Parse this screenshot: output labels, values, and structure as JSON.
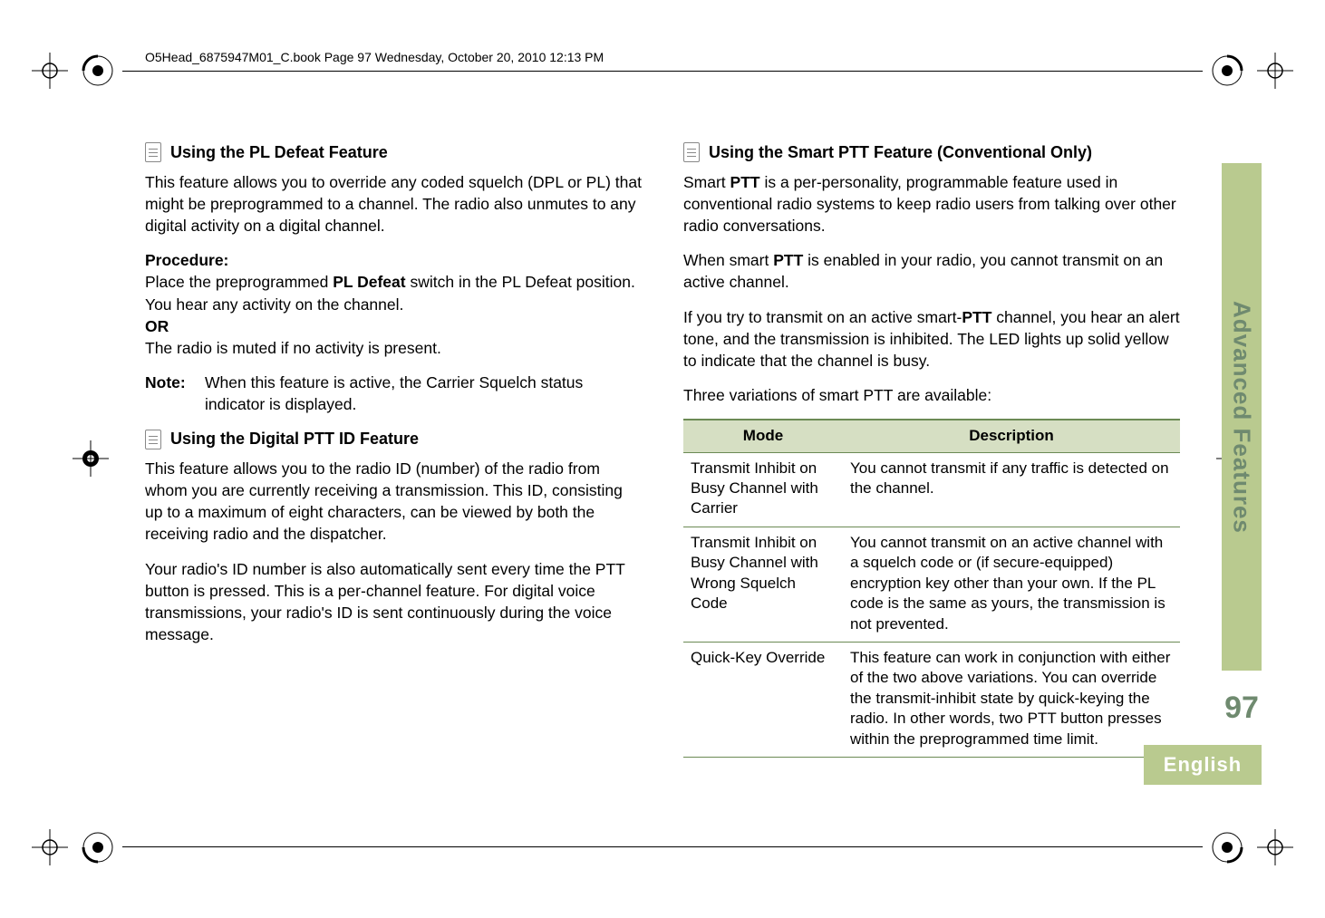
{
  "header_path": "O5Head_6875947M01_C.book  Page 97  Wednesday, October 20, 2010  12:13 PM",
  "side": {
    "section_label": "Advanced Features",
    "page_number": "97",
    "language": "English"
  },
  "left": {
    "h1": "Using the PL Defeat Feature",
    "p1": "This feature allows you to override any coded squelch (DPL or PL) that might be preprogrammed to a channel. The radio also unmutes to any digital activity on a digital channel.",
    "proc_label": "Procedure:",
    "proc1a": "Place the preprogrammed ",
    "proc1b_bold": "PL Defeat",
    "proc1c": " switch in the PL Defeat position. You hear any activity on the channel.",
    "or": "OR",
    "proc2": "The radio is muted if no activity is present.",
    "note_label": "Note:",
    "note_text": "When this feature is active, the Carrier Squelch status indicator is displayed.",
    "h2": "Using the Digital PTT ID Feature",
    "p2": "This feature allows you to the radio ID (number) of the radio from whom you are currently receiving a transmission. This ID, consisting up to a maximum of eight characters, can be viewed by both the receiving radio and the dispatcher.",
    "p3": "Your radio's ID number is also automatically sent every time the PTT button is pressed. This is a per-channel feature. For digital voice transmissions, your radio's ID is sent continuously during the voice message."
  },
  "right": {
    "h1": "Using the Smart PTT Feature (Conventional Only)",
    "p1a": "Smart ",
    "p1b_bold": "PTT",
    "p1c": " is a per-personality, programmable feature used in conventional radio systems to keep radio users from talking over other radio conversations.",
    "p2a": "When smart ",
    "p2b_bold": "PTT",
    "p2c": " is enabled in your radio, you cannot transmit on an active channel.",
    "p3a": "If you try to transmit on an active smart-",
    "p3b_bold": "PTT",
    "p3c": " channel, you hear an alert tone, and the transmission is inhibited. The LED lights up solid yellow to indicate that the channel is busy.",
    "p4": "Three variations of smart PTT are available:",
    "table": {
      "head_mode": "Mode",
      "head_desc": "Description",
      "rows": [
        {
          "mode": "Transmit Inhibit on Busy Channel with Carrier",
          "desc": "You cannot transmit if any traffic is detected on the channel."
        },
        {
          "mode": "Transmit Inhibit on Busy Channel with Wrong Squelch Code",
          "desc": "You cannot transmit on an active channel with a squelch code or (if secure-equipped) encryption key other than your own. If the PL code is the same as yours, the transmission is not prevented."
        },
        {
          "mode": "Quick-Key Override",
          "desc": "This feature can work in conjunction with either of the two above variations. You can override the transmit-inhibit state by quick-keying the radio. In other words, two PTT button presses within the preprogrammed time limit."
        }
      ]
    }
  }
}
